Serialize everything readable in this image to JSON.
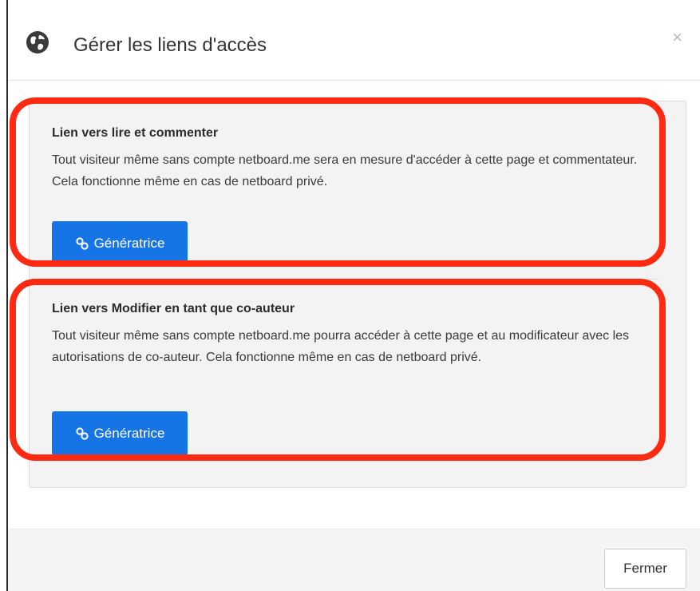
{
  "modal": {
    "title": "Gérer les liens d'accès",
    "title_icon": "globe-icon",
    "close_icon_glyph": "×"
  },
  "sections": [
    {
      "title": "Lien vers lire et commenter",
      "description": "Tout visiteur même sans compte netboard.me sera en mesure d'accéder à cette page et commentateur. Cela fonctionne même en cas de netboard privé.",
      "button_label": "Génératrice",
      "button_icon": "link-icon"
    },
    {
      "title": "Lien vers Modifier en tant que co-auteur",
      "description": "Tout visiteur même sans compte netboard.me pourra accéder à cette page et au modificateur avec les autorisations de co-auteur. Cela fonctionne même en cas de netboard privé.",
      "button_label": "Génératrice",
      "button_icon": "link-icon"
    }
  ],
  "footer": {
    "close_label": "Fermer"
  },
  "colors": {
    "primary_button": "#1675e6",
    "highlight_annotation": "#ff2a12",
    "panel_background": "#f3f3f3"
  }
}
